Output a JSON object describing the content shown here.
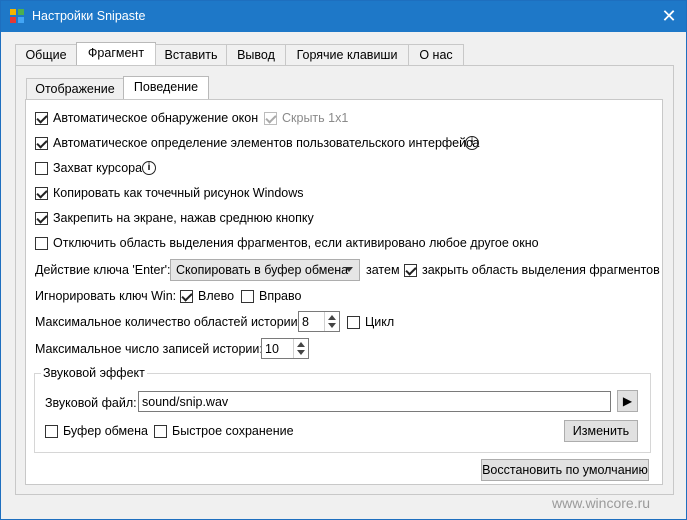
{
  "window": {
    "title": "Настройки Snipaste",
    "close_glyph": "✕"
  },
  "main_tabs": [
    "Общие",
    "Фрагмент",
    "Вставить",
    "Вывод",
    "Горячие клавиши",
    "О нас"
  ],
  "sub_tabs": [
    "Отображение",
    "Поведение"
  ],
  "options": {
    "auto_detect_windows": {
      "label": "Автоматическое обнаружение окон",
      "checked": true
    },
    "hide_1x1": {
      "label": "Скрыть 1x1",
      "checked": true,
      "disabled": true
    },
    "auto_detect_ui": {
      "label": "Автоматическое определение элементов пользовательского интерфейса",
      "checked": true
    },
    "capture_cursor": {
      "label": "Захват курсора",
      "checked": false
    },
    "copy_as_windows_bitmap": {
      "label": "Копировать как точечный рисунок Windows",
      "checked": true
    },
    "pin_middle_click": {
      "label": "Закрепить на экране, нажав среднюю кнопку",
      "checked": true
    },
    "disable_when_other_active": {
      "label": "Отключить область выделения фрагментов, если активировано любое другое окно",
      "checked": false
    }
  },
  "enter_action": {
    "label": "Действие ключа 'Enter':",
    "value": "Скопировать в буфер обмена",
    "then_label": "затем",
    "close_label": "закрыть область выделения фрагментов",
    "close_checked": true
  },
  "ignore_win": {
    "label": "Игнорировать ключ Win:",
    "left_label": "Влево",
    "left_checked": true,
    "right_label": "Вправо",
    "right_checked": false
  },
  "history_areas": {
    "label": "Максимальное количество областей истории:",
    "value": "8",
    "cycle_label": "Цикл",
    "cycle_checked": false
  },
  "history_records": {
    "label": "Максимальное число записей истории:",
    "value": "10"
  },
  "sound": {
    "group_title": "Звуковой эффект",
    "file_label": "Звуковой файл:",
    "file_value": "sound/snip.wav",
    "play_glyph": "▶",
    "clipboard_label": "Буфер обмена",
    "clipboard_checked": false,
    "quicksave_label": "Быстрое сохранение",
    "quicksave_checked": false,
    "change_label": "Изменить"
  },
  "restore_defaults_label": "Восстановить по умолчанию",
  "watermark": "www.wincore.ru",
  "colors": {
    "titlebar": "#1e78c8",
    "window_bg": "#f0f0f0",
    "panel_bg": "#ffffff"
  }
}
